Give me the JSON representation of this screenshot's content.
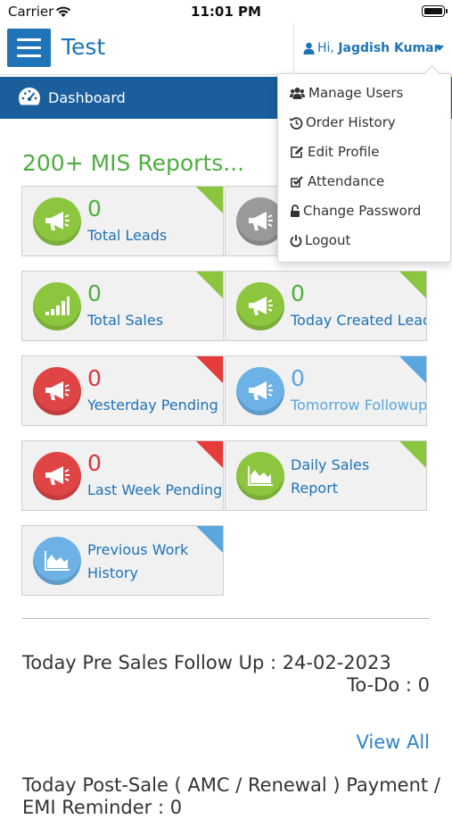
{
  "status_bar": {
    "carrier": "Carrier",
    "time": "11:01 PM"
  },
  "app": {
    "title": "Test"
  },
  "user": {
    "greeting": "Hi,",
    "name": "Jagdish Kumar"
  },
  "nav": {
    "dashboard_label": "Dashboard"
  },
  "user_dropdown": {
    "items": [
      {
        "label": "Manage Users",
        "icon": "users-icon"
      },
      {
        "label": "Order History",
        "icon": "history-icon"
      },
      {
        "label": "Edit Profile",
        "icon": "edit-icon"
      },
      {
        "label": "Attendance",
        "icon": "checkbox-icon"
      },
      {
        "label": "Change Password",
        "icon": "lock-icon"
      },
      {
        "label": "Logout",
        "icon": "power-icon"
      }
    ]
  },
  "main": {
    "section_title": "200+ MIS Reports...",
    "tiles": [
      {
        "count": "0",
        "label": "Total Leads",
        "color": "#8cc63f",
        "icon": "megaphone-icon"
      },
      {
        "count": "",
        "label": "",
        "color": "#9a9a9a",
        "icon": "megaphone-icon"
      },
      {
        "count": "0",
        "label": "Total Sales",
        "color": "#8cc63f",
        "icon": "signal-bars-icon"
      },
      {
        "count": "0",
        "label": "Today Created Lead",
        "color": "#8cc63f",
        "icon": "megaphone-icon"
      },
      {
        "count": "0",
        "label": "Yesterday Pending",
        "color": "#e53b3b",
        "icon": "megaphone-icon"
      },
      {
        "count": "0",
        "label": "Tomorrow Followup",
        "color": "#5aa6df",
        "icon": "megaphone-icon"
      },
      {
        "count": "0",
        "label": "Last Week Pendings",
        "color": "#e53b3b",
        "icon": "megaphone-icon"
      },
      {
        "label": "Daily Sales Report",
        "color": "#8cc63f",
        "icon": "area-chart-icon"
      },
      {
        "label": "Previous Work History",
        "color": "#5aa6df",
        "icon": "area-chart-icon"
      }
    ],
    "pre_sales": {
      "title": "Today Pre Sales Follow Up : 24-02-2023",
      "todo": "To-Do : 0",
      "view_all": "View All"
    },
    "post_sale": {
      "title": "Today Post-Sale ( AMC / Renewal ) Payment / EMI Reminder : 0"
    }
  }
}
